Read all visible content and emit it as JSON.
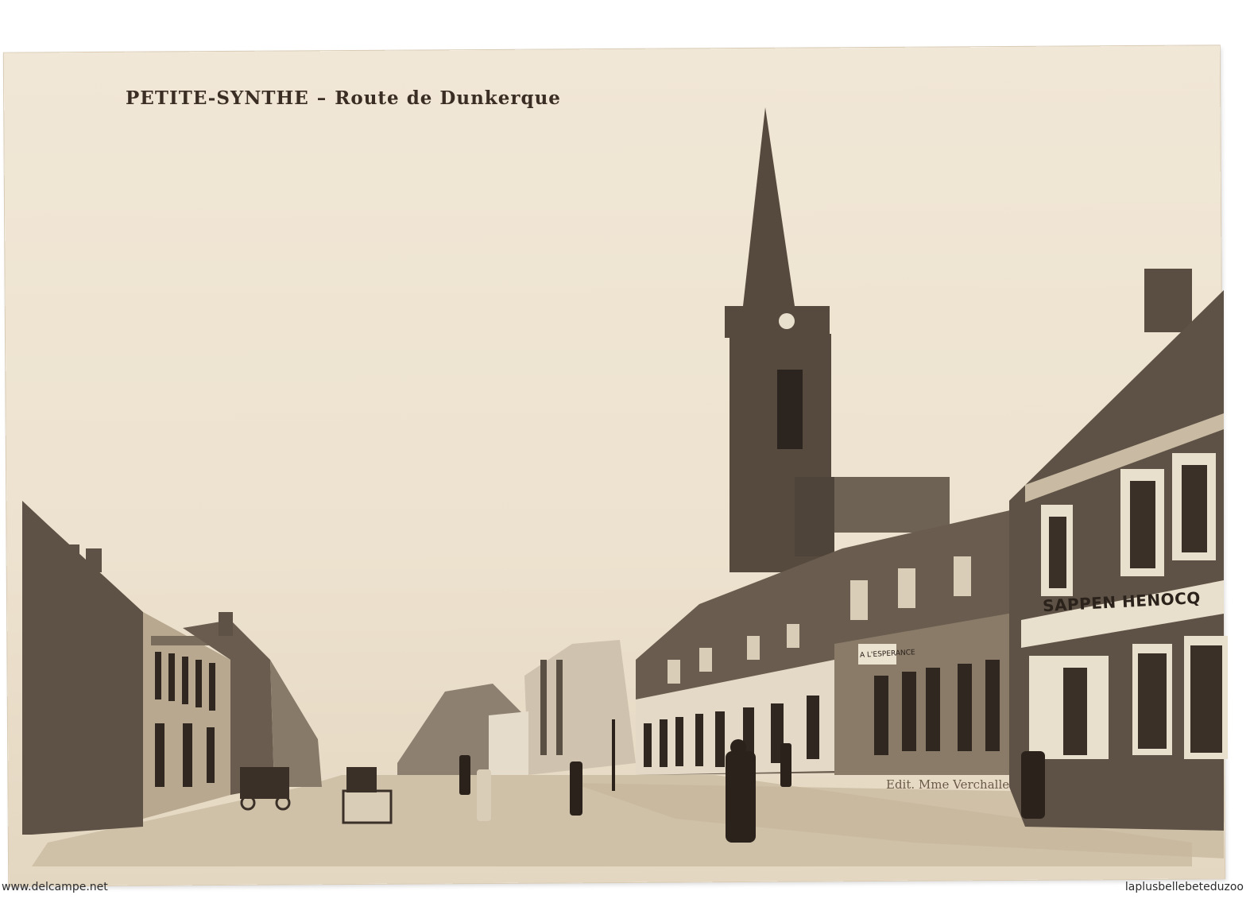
{
  "postcard": {
    "caption_place": "PETITE-SYNTHE",
    "caption_separator": "–",
    "caption_street": "Route de Dunkerque",
    "shop_sign": "SAPPEN HENOCQ",
    "small_sign": "A L'ESPERANCE",
    "publisher": "Edit. Mme Verchalle"
  },
  "watermarks": {
    "left": "www.delcampe.net",
    "right": "laplusbellebeteduzoo"
  },
  "colors": {
    "card": "#ede2cf",
    "ink": "#3a2e24",
    "sky": "#efe5d3"
  }
}
